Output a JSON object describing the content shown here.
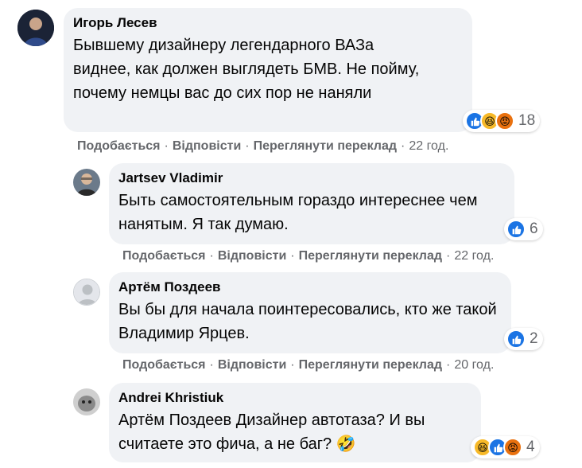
{
  "action_labels": {
    "like": "Подобається",
    "reply": "Відповісти",
    "translate": "Переглянути переклад",
    "separator": "·"
  },
  "comments": [
    {
      "author": "Игорь Лесев",
      "text": "Бывшему дизайнеру легендарного ВАЗа виднее, как должен выглядеть БМВ. Не пойму, почему немцы вас до сих пор не наняли",
      "reaction_count": "18",
      "reactions": [
        "like-icon",
        "haha-icon",
        "angry-icon"
      ],
      "time": "22 год."
    },
    {
      "author": "Jartsev Vladimir",
      "text": "Быть самостоятельным гораздо интереснее чем нанятым. Я так думаю.",
      "reaction_count": "6",
      "reactions": [
        "like-icon"
      ],
      "time": "22 год."
    },
    {
      "author": "Артём Поздеев",
      "text": "Вы бы для начала поинтересовались, кто же такой Владимир Ярцев.",
      "reaction_count": "2",
      "reactions": [
        "like-icon"
      ],
      "time": "20 год."
    },
    {
      "author": "Andrei Khristiuk",
      "text": "Артём Поздеев Дизайнер автотаза? И вы считаете это фича, а не баг? 🤣",
      "reaction_count": "4",
      "reactions": [
        "haha-icon",
        "like-icon",
        "angry-icon"
      ],
      "time": ""
    }
  ],
  "colors": {
    "bubble": "#f0f2f5",
    "secondary_text": "#65676b",
    "like": "#1b74e4",
    "haha": "#f7b928",
    "angry": "#e9710f"
  }
}
